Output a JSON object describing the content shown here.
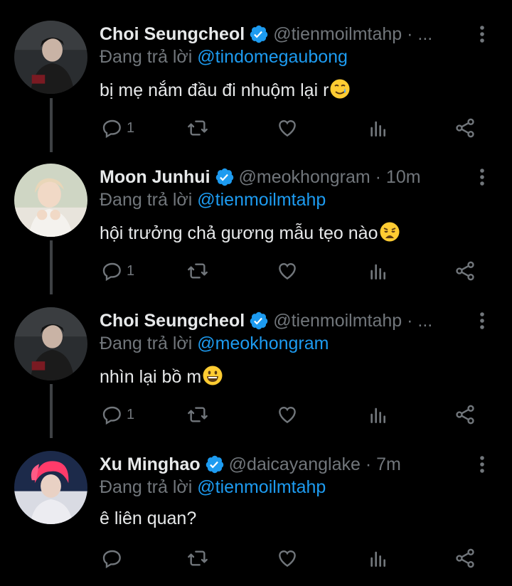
{
  "colors": {
    "background": "#000000",
    "text": "#e7e9ea",
    "muted": "#71767b",
    "accent": "#1d9bf0",
    "thread_line": "#3e4144"
  },
  "replying_prefix": "Đang trả lời",
  "tweets": [
    {
      "name": "Choi Seungcheol",
      "handle_meta": "@tienmoilmtahp · ...",
      "replying_to": "@tindomegaubong",
      "text": "bị mẹ nắm đầu đi nhuộm lại r",
      "emoji": "smiling-face-with-tear-emoji",
      "reply_count": "1",
      "avatar": "seungcheol-avatar"
    },
    {
      "name": "Moon Junhui",
      "handle_meta": "@meokhongram · 10m",
      "replying_to": "@tienmoilmtahp",
      "text": "hội trưởng chả gương mẫu tẹo nào",
      "emoji": "weary-face-emoji",
      "reply_count": "1",
      "avatar": "junhui-avatar"
    },
    {
      "name": "Choi Seungcheol",
      "handle_meta": "@tienmoilmtahp · ...",
      "replying_to": "@meokhongram",
      "text": "nhìn lại bồ m",
      "emoji": "grinning-face-emoji",
      "reply_count": "1",
      "avatar": "seungcheol-avatar"
    },
    {
      "name": "Xu Minghao",
      "handle_meta": "@daicayanglake · 7m",
      "replying_to": "@tienmoilmtahp",
      "text": "ê liên quan?",
      "emoji": "",
      "reply_count": "",
      "avatar": "minghao-avatar"
    }
  ]
}
